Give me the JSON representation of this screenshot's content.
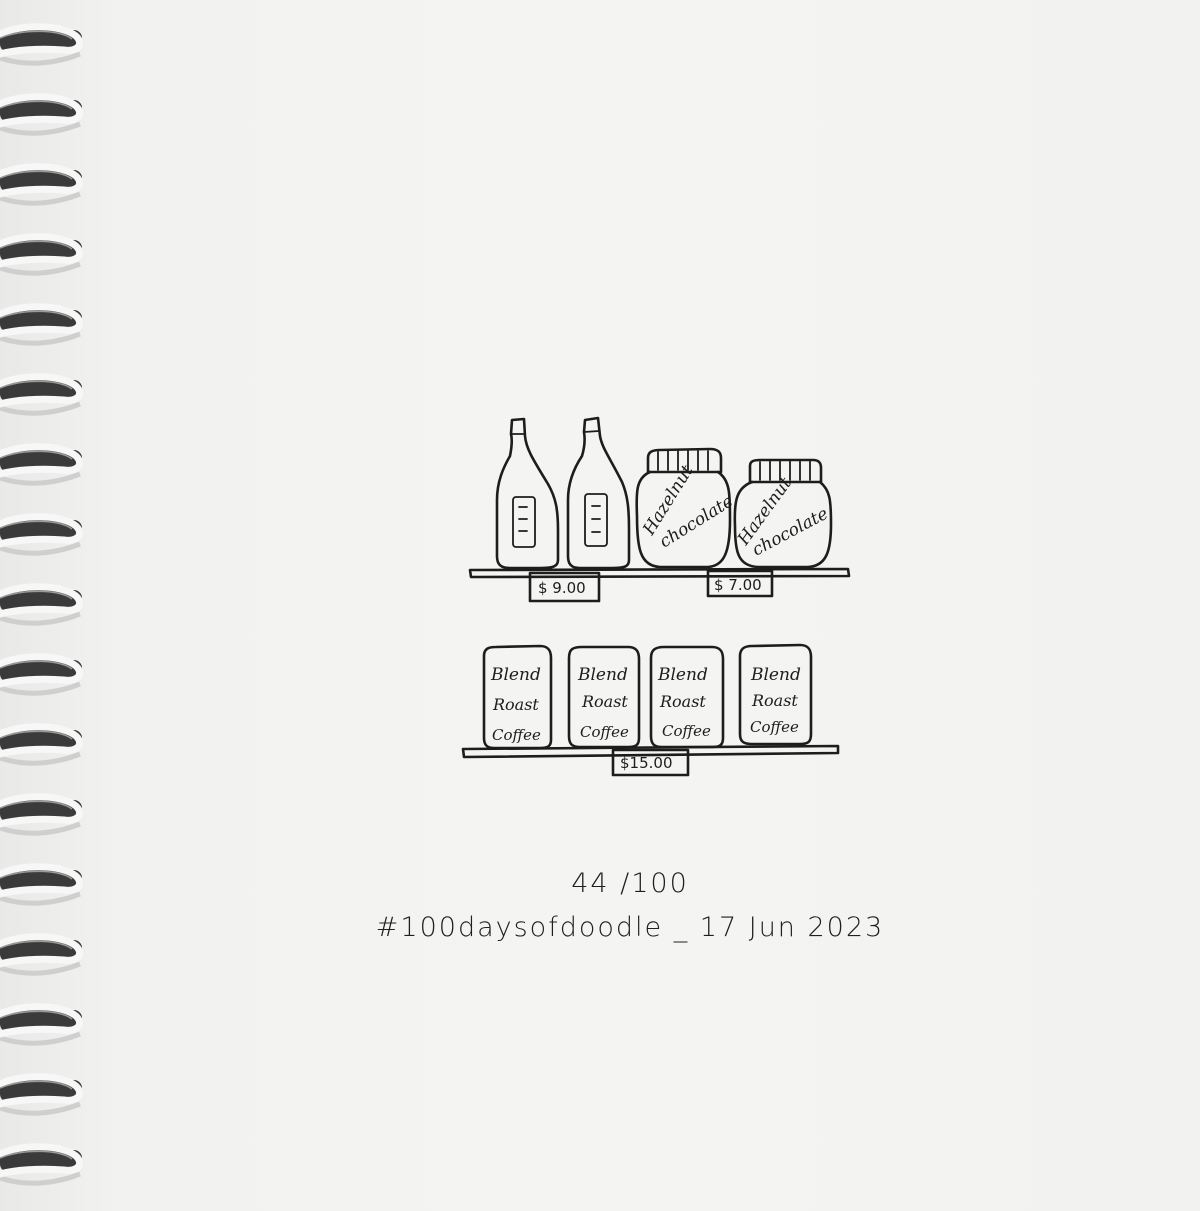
{
  "bottles": {
    "price": "$ 9.00"
  },
  "jars": {
    "label_line1": "Hazelnut",
    "label_line2": "chocolate",
    "price": "$ 7.00"
  },
  "coffee": {
    "bags": [
      [
        "Blend",
        "Roast",
        "Coffee"
      ],
      [
        "Blend",
        "Roast",
        "Coffee"
      ],
      [
        "Blend",
        "Roast",
        "Coffee"
      ],
      [
        "Blend",
        "Roast",
        "Coffee"
      ]
    ],
    "price": "$15.00"
  },
  "caption": {
    "count": "44 /100",
    "tag": "#100daysofdoodle _ 17 Jun 2023"
  },
  "colors": {
    "paper": "#f3f3f1",
    "ink": "#1d1d1d",
    "coil": "#f7f7f7"
  }
}
